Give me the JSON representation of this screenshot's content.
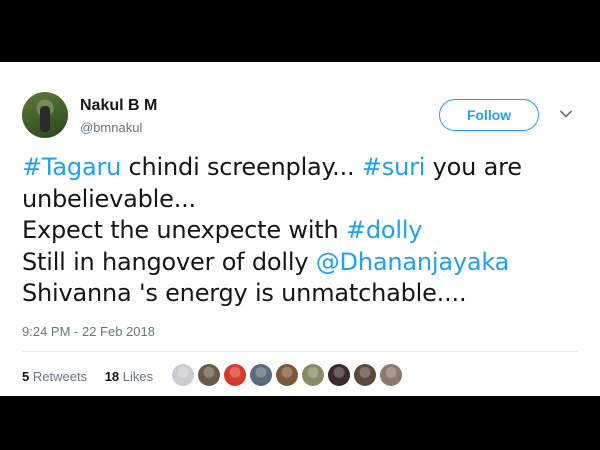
{
  "user": {
    "name": "Nakul B M",
    "handle": "@bmnakul"
  },
  "follow_label": "Follow",
  "tweet": {
    "lines": [
      [
        {
          "text": "#Tagaru",
          "link": true
        },
        {
          "text": " chindi screenplay... ",
          "link": false
        },
        {
          "text": "#suri",
          "link": true
        },
        {
          "text": " you are",
          "link": false
        }
      ],
      [
        {
          "text": "unbelievable...",
          "link": false
        }
      ],
      [
        {
          "text": "Expect the unexpecte with ",
          "link": false
        },
        {
          "text": "#dolly",
          "link": true
        }
      ],
      [
        {
          "text": "Still in hangover of dolly ",
          "link": false
        },
        {
          "text": "@Dhananjayaka",
          "link": true
        }
      ],
      [
        {
          "text": "Shivanna 's energy is unmatchable....",
          "link": false
        }
      ]
    ]
  },
  "timestamp": "9:24 PM - 22 Feb 2018",
  "stats": {
    "retweets_count": "5",
    "retweets_label": "Retweets",
    "likes_count": "18",
    "likes_label": "Likes"
  },
  "liker_avatar_colors": [
    "#c7ccd1",
    "#6b5a4a",
    "#d63a2a",
    "#5a6a7a",
    "#7a5a3a",
    "#8a8a6a",
    "#3a2a2a",
    "#5a4a3a",
    "#8a7a6a"
  ],
  "colors": {
    "accent": "#1da1f2",
    "text": "#14171a",
    "secondary": "#657786"
  }
}
